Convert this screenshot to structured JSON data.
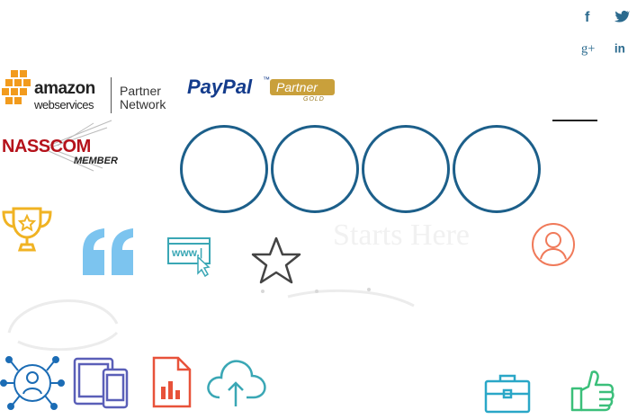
{
  "social": {
    "items": [
      {
        "name": "facebook",
        "glyph": "f"
      },
      {
        "name": "twitter",
        "glyph": ""
      },
      {
        "name": "google-plus",
        "glyph": "g+"
      },
      {
        "name": "linkedin",
        "glyph": "in"
      }
    ]
  },
  "partners": {
    "aws": {
      "word1": "amazon",
      "word2": "webservices",
      "label1": "Partner",
      "label2": "Network"
    },
    "paypal": {
      "brand": "PayPal",
      "tm": "™",
      "badge": "Partner",
      "tier": "GOLD"
    },
    "nasscom": {
      "name": "NASSCOM",
      "member": "MEMBER"
    }
  },
  "hero": {
    "faded_text": "Starts Here"
  },
  "colors": {
    "ring": "#1c5f8a",
    "trophy": "#f0b323",
    "quote": "#7cc4ef",
    "www": "#3aa7b5",
    "user_circle": "#f07a5a",
    "network": "#1b6cb5",
    "devices": "#5a5fb8",
    "doc": "#e8523a",
    "cloud": "#3aa7b5",
    "briefcase": "#2aa7c7",
    "thumb": "#3bbf7a"
  },
  "www_icon": {
    "text": "www.|"
  }
}
